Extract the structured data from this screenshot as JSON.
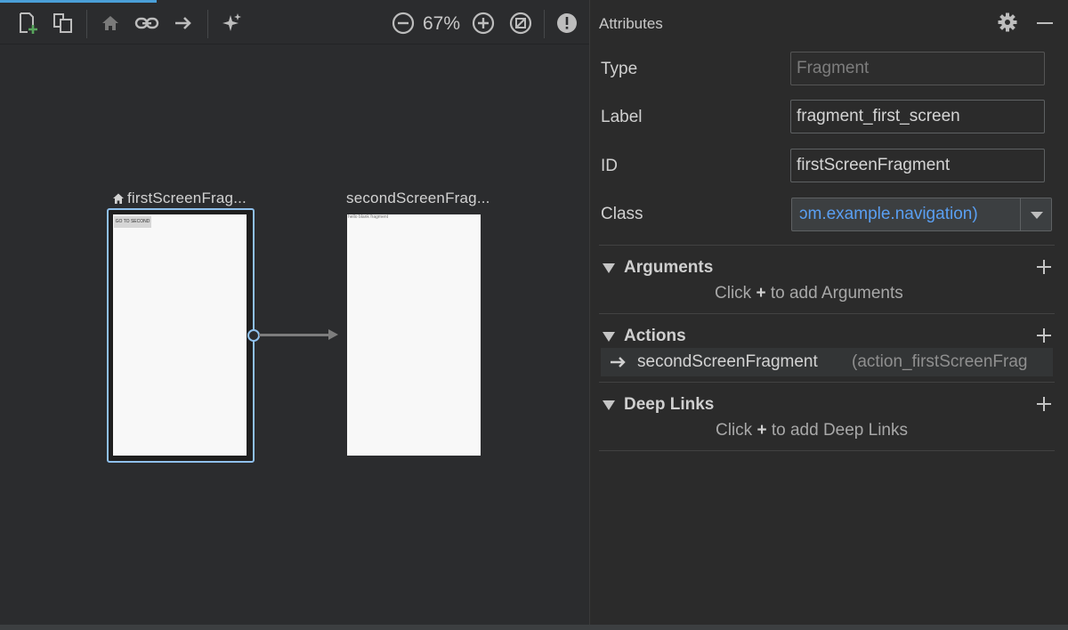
{
  "toolbar": {
    "zoom_level": "67%",
    "icons": [
      "new-destination-icon",
      "nested-graph-icon",
      "home-icon",
      "link-icon",
      "action-arrow-icon",
      "auto-arrange-icon",
      "zoom-out-icon",
      "zoom-in-icon",
      "zoom-to-fit-icon",
      "warning-icon"
    ]
  },
  "canvas": {
    "nodes": [
      {
        "title": "firstScreenFrag...",
        "button_text": "GO TO SECOND",
        "selected": true,
        "is_start": true
      },
      {
        "title": "secondScreenFrag...",
        "body_text": "hello blank fragment",
        "selected": false,
        "is_start": false
      }
    ]
  },
  "attributes": {
    "title": "Attributes",
    "type_label": "Type",
    "type_value": "Fragment",
    "label_label": "Label",
    "label_value": "fragment_first_screen",
    "id_label": "ID",
    "id_value": "firstScreenFragment",
    "class_label": "Class",
    "class_value": "ɔm.example.navigation)",
    "arguments": {
      "title": "Arguments",
      "hint_prefix": "Click",
      "hint_plus": "+",
      "hint_suffix": "to add Arguments"
    },
    "actions": {
      "title": "Actions",
      "destination": "secondScreenFragment",
      "action_id": "(action_firstScreenFrag"
    },
    "deep_links": {
      "title": "Deep Links",
      "hint_prefix": "Click",
      "hint_plus": "+",
      "hint_suffix": "to add Deep Links"
    }
  },
  "colors": {
    "accent": "#8fc0ec",
    "link": "#5a9ff2",
    "add": "#58a55c"
  }
}
